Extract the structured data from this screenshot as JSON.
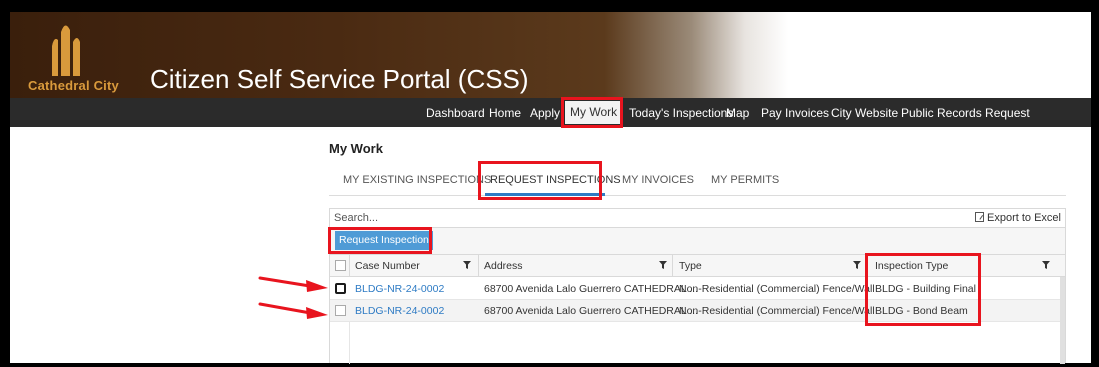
{
  "header": {
    "logo_text": "Cathedral City",
    "portal_title": "Citizen Self Service Portal (CSS)"
  },
  "nav": {
    "items": [
      "Dashboard",
      "Home",
      "Apply",
      "My Work",
      "Today's Inspections",
      "Map",
      "Pay Invoices",
      "City Website",
      "Public Records Request"
    ],
    "active": "My Work"
  },
  "page": {
    "title": "My Work"
  },
  "tabs": [
    "MY EXISTING INSPECTIONS",
    "REQUEST INSPECTIONS",
    "MY INVOICES",
    "MY PERMITS"
  ],
  "active_tab": "REQUEST INSPECTIONS",
  "search": {
    "placeholder": "Search...",
    "value": ""
  },
  "toolbar": {
    "export_label": "Export to Excel",
    "request_label": "Request Inspection"
  },
  "grid": {
    "columns": [
      "Case Number",
      "Address",
      "Type",
      "Inspection Type"
    ],
    "rows": [
      {
        "case_number": "BLDG-NR-24-0002",
        "address": "68700 Avenida Lalo Guerrero CATHEDRAL ...",
        "type": "Non-Residential (Commercial) Fence/Wall",
        "inspection_type": "BLDG - Building Final"
      },
      {
        "case_number": "BLDG-NR-24-0002",
        "address": "68700 Avenida Lalo Guerrero CATHEDRAL ...",
        "type": "Non-Residential (Commercial) Fence/Wall",
        "inspection_type": "BLDG - Bond Beam"
      }
    ]
  },
  "colors": {
    "header_brown": "#3a1f0c",
    "logo_gold": "#d99a3c",
    "navbar": "#2b2b2b",
    "accent_blue": "#2e7bc4",
    "button_blue": "#4f9bd6",
    "highlight_red": "#e8141e"
  },
  "icons": [
    "cathedral-logo-icon",
    "excel-export-icon",
    "filter-icon",
    "red-arrow-icon"
  ]
}
